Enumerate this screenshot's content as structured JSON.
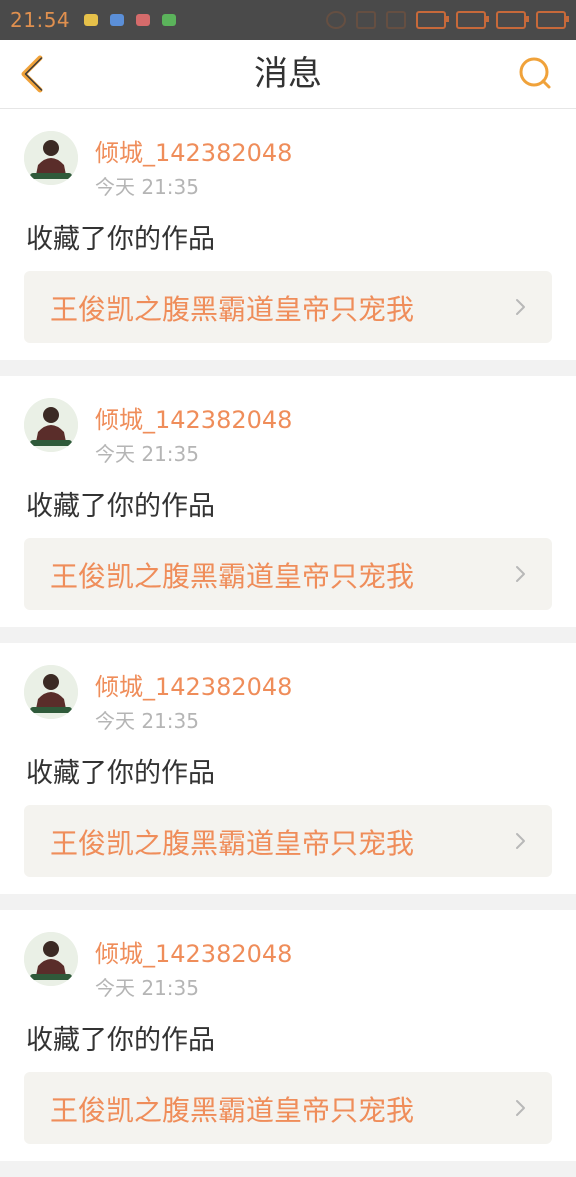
{
  "status_bar": {
    "time": "21:54"
  },
  "header": {
    "title": "消息",
    "back_icon": "chevron-left-icon",
    "search_icon": "search-icon",
    "accent": "#f0a23a"
  },
  "messages": [
    {
      "user": "倾城_142382048",
      "time": "今天 21:35",
      "action": "收藏了你的作品",
      "work_title": "王俊凯之腹黑霸道皇帝只宠我"
    },
    {
      "user": "倾城_142382048",
      "time": "今天 21:35",
      "action": "收藏了你的作品",
      "work_title": "王俊凯之腹黑霸道皇帝只宠我"
    },
    {
      "user": "倾城_142382048",
      "time": "今天 21:35",
      "action": "收藏了你的作品",
      "work_title": "王俊凯之腹黑霸道皇帝只宠我"
    },
    {
      "user": "倾城_142382048",
      "time": "今天 21:35",
      "action": "收藏了你的作品",
      "work_title": "王俊凯之腹黑霸道皇帝只宠我"
    }
  ],
  "colors": {
    "username": "#ef8d5a",
    "work_title": "#ef8d5a",
    "link_bg": "#f4f3ef",
    "page_bg": "#f2f2f2"
  }
}
